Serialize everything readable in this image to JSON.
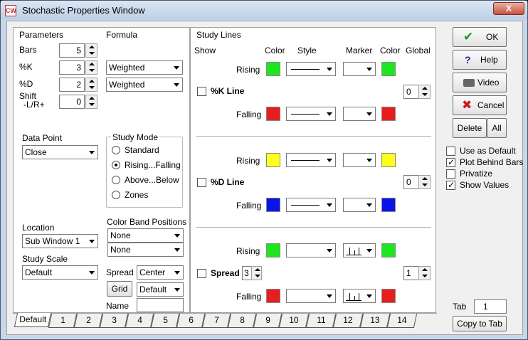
{
  "window": {
    "title": "Stochastic Properties Window",
    "icon_text": "CW",
    "close_label": "X"
  },
  "colors": {
    "green": "#1ee61e",
    "red": "#e61e1e",
    "yellow": "#ffff1e",
    "blue": "#0a14e6"
  },
  "parameters": {
    "title": "Parameters",
    "bars_label": "Bars",
    "bars_value": "5",
    "k_label": "%K",
    "k_value": "3",
    "d_label": "%D",
    "d_value": "2",
    "shift_label": "Shift",
    "shift_sub": "-L/R+",
    "shift_value": "0"
  },
  "formula": {
    "title": "Formula",
    "k_value": "Weighted",
    "d_value": "Weighted"
  },
  "data_point": {
    "label": "Data Point",
    "value": "Close"
  },
  "study_mode": {
    "title": "Study Mode",
    "options": [
      "Standard",
      "Rising...Falling",
      "Above...Below",
      "Zones"
    ],
    "selected": 1
  },
  "location": {
    "label": "Location",
    "value": "Sub Window  1"
  },
  "study_scale": {
    "label": "Study Scale",
    "value": "Default"
  },
  "color_band": {
    "label": "Color Band Positions",
    "value1": "None",
    "value2": "None"
  },
  "spread": {
    "label": "Spread",
    "value": "Center"
  },
  "grid": {
    "label": "Grid",
    "value": "Default"
  },
  "name": {
    "label": "Name",
    "value": ""
  },
  "study_lines": {
    "title": "Study Lines",
    "headers": {
      "show": "Show",
      "color": "Color",
      "style": "Style",
      "marker": "Marker",
      "color2": "Color",
      "global": "Global"
    },
    "rising": "Rising",
    "falling": "Falling",
    "k_line": {
      "label": "%K Line",
      "global": "0"
    },
    "d_line": {
      "label": "%D Line",
      "global": "0"
    },
    "spread_row": {
      "label": "Spread",
      "spread_value": "3",
      "global": "1"
    }
  },
  "buttons": {
    "ok": "OK",
    "help": "Help",
    "video": "Video",
    "cancel": "Cancel",
    "delete": "Delete",
    "all": "All",
    "copy_to_tab": "Copy to Tab"
  },
  "options": [
    {
      "label": "Use as Default",
      "checked": false
    },
    {
      "label": "Plot Behind Bars",
      "checked": true
    },
    {
      "label": "Privatize",
      "checked": false
    },
    {
      "label": "Show Values",
      "checked": true
    }
  ],
  "tab_field": {
    "label": "Tab",
    "value": "1"
  },
  "tabs": [
    "Default",
    "1",
    "2",
    "3",
    "4",
    "5",
    "6",
    "7",
    "8",
    "9",
    "10",
    "11",
    "12",
    "13",
    "14"
  ]
}
